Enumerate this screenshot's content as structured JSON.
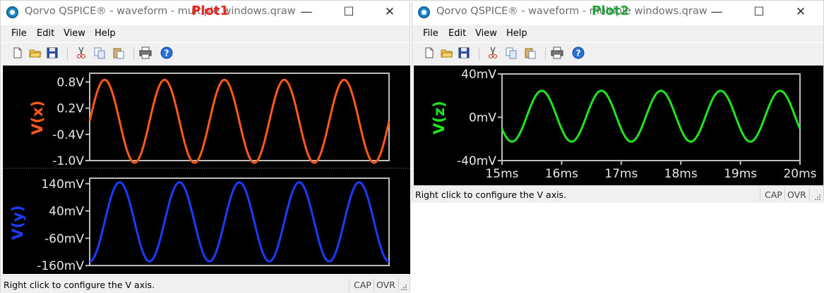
{
  "windows": [
    {
      "title": "Qorvo QSPICE® - waveform - multiple windows.qraw",
      "plot_label": "Plot1",
      "plot_label_color": "#e8231b",
      "menu": [
        "File",
        "Edit",
        "View",
        "Help"
      ],
      "status": "Right click to configure the V axis.",
      "indicators": [
        "CAP",
        "OVR"
      ]
    },
    {
      "title": "Qorvo QSPICE® - waveform - multiple windows.qraw",
      "plot_label": "Plot2",
      "plot_label_color": "#1ea53a",
      "menu": [
        "File",
        "Edit",
        "View",
        "Help"
      ],
      "status": "Right click to configure the V axis.",
      "indicators": [
        "CAP",
        "OVR"
      ]
    }
  ],
  "window_controls": [
    "—",
    "☐",
    "✕"
  ],
  "toolbar_icons": [
    "new-file-icon",
    "open-folder-icon",
    "save-icon",
    "cut-icon",
    "copy-icon",
    "paste-icon",
    "print-icon",
    "help-icon"
  ],
  "chart_data": [
    {
      "type": "line",
      "ylabel": "V(x)",
      "series": [
        {
          "name": "V(x)",
          "color": "#ff5a1a",
          "offset": -0.1,
          "amplitude": 0.95,
          "frequency_hz": 1000,
          "phase_deg": 0
        }
      ],
      "x_range_ms": [
        15,
        20
      ],
      "ylim": [
        -1.0,
        1.0
      ],
      "yticks": [
        0.8,
        0.2,
        -0.4,
        -1.0
      ],
      "ytick_labels": [
        "0.8V",
        "0.2V",
        "-0.4V",
        "-1.0V"
      ]
    },
    {
      "type": "line",
      "ylabel": "V(y)",
      "series": [
        {
          "name": "V(y)",
          "color": "#1a3cff",
          "offset": 0,
          "amplitude": 0.145,
          "frequency_hz": 1000,
          "phase_deg": -90
        }
      ],
      "x_range_ms": [
        15,
        20
      ],
      "ylim": [
        -0.16,
        0.16
      ],
      "yticks": [
        0.14,
        0.04,
        -0.06,
        -0.16
      ],
      "ytick_labels": [
        "140mV",
        "40mV",
        "-60mV",
        "-160mV"
      ]
    },
    {
      "type": "line",
      "ylabel": "V(z)",
      "series": [
        {
          "name": "V(z)",
          "color": "#1ee61e",
          "offset": 0.001,
          "amplitude": 0.0235,
          "frequency_hz": 1000,
          "phase_deg": -150
        }
      ],
      "x_range_ms": [
        15,
        20
      ],
      "xticks": [
        15,
        16,
        17,
        18,
        19,
        20
      ],
      "xtick_labels": [
        "15ms",
        "16ms",
        "17ms",
        "18ms",
        "19ms",
        "20ms"
      ],
      "ylim": [
        -0.04,
        0.04
      ],
      "yticks": [
        0.04,
        0.0,
        -0.04
      ],
      "ytick_labels": [
        "40mV",
        "0mV",
        "-40mV"
      ]
    }
  ]
}
